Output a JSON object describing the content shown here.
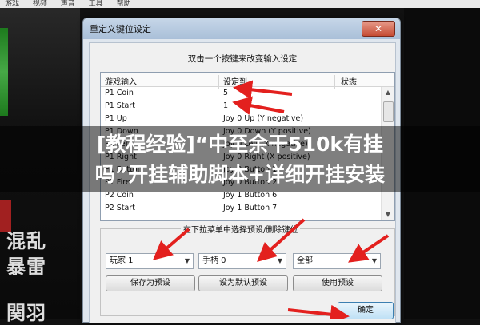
{
  "background": {
    "menubar": [
      "游戏",
      "视频",
      "声音",
      "工具",
      "帮助"
    ],
    "side_text": [
      "混乱",
      "暴雷",
      "関羽"
    ]
  },
  "dialog": {
    "title": "重定义键位设定",
    "close_label": "✕",
    "instruction": "双击一个按键来改变输入设定",
    "columns": [
      "游戏输入",
      "设定到",
      "状态"
    ],
    "rows": [
      {
        "input": "P1 Coin",
        "mapping": "5"
      },
      {
        "input": "P1 Start",
        "mapping": "1"
      },
      {
        "input": "P1 Up",
        "mapping": "Joy 0 Up (Y negative)"
      },
      {
        "input": "P1 Down",
        "mapping": "Joy 0 Down (Y positive)"
      },
      {
        "input": "P1 Left",
        "mapping": "Joy 0 Left (X negative)"
      },
      {
        "input": "P1 Right",
        "mapping": "Joy 0 Right (X positive)"
      },
      {
        "input": "P1 Button",
        "mapping": "Joy 0 Button 1"
      },
      {
        "input": "P1 Fire",
        "mapping": "Joy 0 Button 2"
      },
      {
        "input": "P2 Coin",
        "mapping": "Joy 1 Button 6"
      },
      {
        "input": "P2 Start",
        "mapping": "Joy 1 Button 7"
      }
    ],
    "group_title": "在下拉菜单中选择预设/删除键位",
    "combos": [
      {
        "value": "玩家 1"
      },
      {
        "value": "手柄 0"
      },
      {
        "value": "全部"
      }
    ],
    "buttons": {
      "save_preset": "保存为预设",
      "set_default": "设为默认预设",
      "use_preset": "使用预设"
    },
    "ok_label": "确定"
  },
  "overlay": {
    "watermark_line1": "[教程经验]“中至余干510k有挂",
    "watermark_line2": "吗”开挂辅助脚本+详细开挂安装"
  },
  "colors": {
    "arrow_red": "#e3201e",
    "titlebar": "#b5c8de",
    "window_bg": "#f0f0f0"
  }
}
